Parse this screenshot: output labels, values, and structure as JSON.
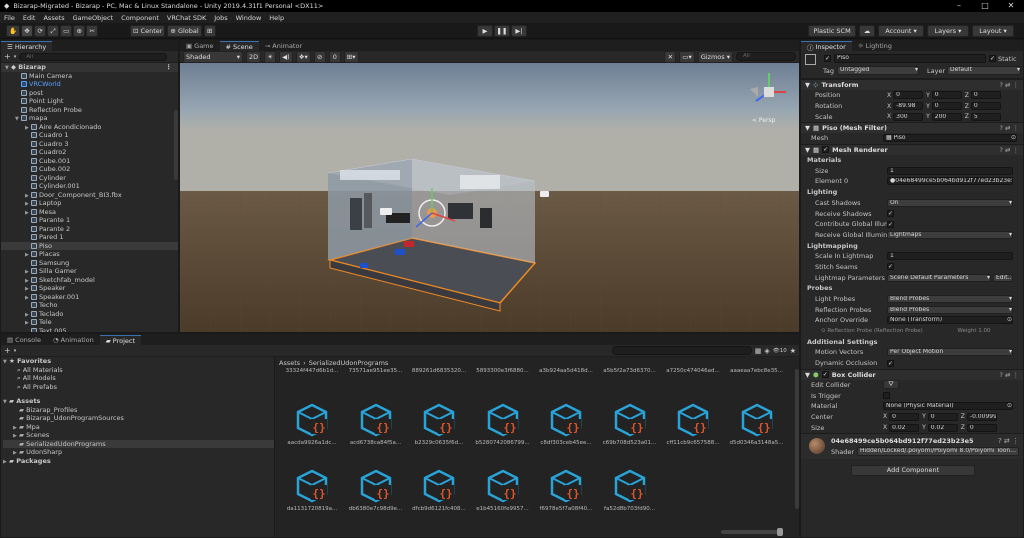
{
  "window": {
    "title": "Bizarap-Migrated - Bizarap - PC, Mac & Linux Standalone - Unity 2019.4.31f1 Personal <DX11>"
  },
  "menu": [
    "File",
    "Edit",
    "Assets",
    "GameObject",
    "Component",
    "VRChat SDK",
    "Jobs",
    "Window",
    "Help"
  ],
  "toolbar": {
    "pivot_label": "Center",
    "space_label": "Global",
    "plastic_label": "Plastic SCM",
    "account_label": "Account",
    "layers_label": "Layers",
    "layout_label": "Layout"
  },
  "hierarchy": {
    "tab": "Hierarchy",
    "search_placeholder": "All",
    "scene_name": "Bizarap",
    "items": [
      {
        "label": "Main Camera",
        "depth": 1,
        "arrow": "",
        "selected": false,
        "prefab": false
      },
      {
        "label": "VRCWorld",
        "depth": 1,
        "arrow": "",
        "selected": false,
        "prefab": true
      },
      {
        "label": "post",
        "depth": 1,
        "arrow": "",
        "selected": false,
        "prefab": false
      },
      {
        "label": "Point Light",
        "depth": 1,
        "arrow": "",
        "selected": false,
        "prefab": false
      },
      {
        "label": "Reflection Probe",
        "depth": 1,
        "arrow": "",
        "selected": false,
        "prefab": false
      },
      {
        "label": "mapa",
        "depth": 1,
        "arrow": "▼",
        "selected": false,
        "prefab": false
      },
      {
        "label": "Aire Acondicionado",
        "depth": 2,
        "arrow": "▶",
        "selected": false,
        "prefab": false
      },
      {
        "label": "Cuadro 1",
        "depth": 2,
        "arrow": "",
        "selected": false,
        "prefab": false
      },
      {
        "label": "Cuadro 3",
        "depth": 2,
        "arrow": "",
        "selected": false,
        "prefab": false
      },
      {
        "label": "Cuadro2",
        "depth": 2,
        "arrow": "",
        "selected": false,
        "prefab": false
      },
      {
        "label": "Cube.001",
        "depth": 2,
        "arrow": "",
        "selected": false,
        "prefab": false
      },
      {
        "label": "Cube.002",
        "depth": 2,
        "arrow": "",
        "selected": false,
        "prefab": false
      },
      {
        "label": "Cylinder",
        "depth": 2,
        "arrow": "",
        "selected": false,
        "prefab": false
      },
      {
        "label": "Cylinder.001",
        "depth": 2,
        "arrow": "",
        "selected": false,
        "prefab": false
      },
      {
        "label": "Door_Component_BI3.fbx",
        "depth": 2,
        "arrow": "▶",
        "selected": false,
        "prefab": false
      },
      {
        "label": "Laptop",
        "depth": 2,
        "arrow": "▶",
        "selected": false,
        "prefab": false
      },
      {
        "label": "Mesa",
        "depth": 2,
        "arrow": "▶",
        "selected": false,
        "prefab": false
      },
      {
        "label": "Parante 1",
        "depth": 2,
        "arrow": "",
        "selected": false,
        "prefab": false
      },
      {
        "label": "Parante 2",
        "depth": 2,
        "arrow": "",
        "selected": false,
        "prefab": false
      },
      {
        "label": "Pared 1",
        "depth": 2,
        "arrow": "",
        "selected": false,
        "prefab": false
      },
      {
        "label": "Piso",
        "depth": 2,
        "arrow": "",
        "selected": true,
        "prefab": false
      },
      {
        "label": "Placas",
        "depth": 2,
        "arrow": "▶",
        "selected": false,
        "prefab": false
      },
      {
        "label": "Samsung",
        "depth": 2,
        "arrow": "",
        "selected": false,
        "prefab": false
      },
      {
        "label": "Silla Gamer",
        "depth": 2,
        "arrow": "▶",
        "selected": false,
        "prefab": false
      },
      {
        "label": "Sketchfab_model",
        "depth": 2,
        "arrow": "▶",
        "selected": false,
        "prefab": false
      },
      {
        "label": "Speaker",
        "depth": 2,
        "arrow": "▶",
        "selected": false,
        "prefab": false
      },
      {
        "label": "Speaker.001",
        "depth": 2,
        "arrow": "▶",
        "selected": false,
        "prefab": false
      },
      {
        "label": "Techo",
        "depth": 2,
        "arrow": "",
        "selected": false,
        "prefab": false
      },
      {
        "label": "Teclado",
        "depth": 2,
        "arrow": "▶",
        "selected": false,
        "prefab": false
      },
      {
        "label": "Tele",
        "depth": 2,
        "arrow": "▶",
        "selected": false,
        "prefab": false
      },
      {
        "label": "Text.005",
        "depth": 2,
        "arrow": "",
        "selected": false,
        "prefab": false
      }
    ]
  },
  "scene": {
    "tabs": [
      "Game",
      "Scene",
      "Animator"
    ],
    "shading": "Shaded",
    "mode_2d": "2D",
    "layer_count": "0",
    "gizmos_label": "Gizmos",
    "search_placeholder": "All",
    "persp_label": "< Persp"
  },
  "inspector": {
    "tabs": [
      "Inspector",
      "Lighting"
    ],
    "object_name": "Piso",
    "static_label": "Static",
    "tag_label": "Tag",
    "tag_value": "Untagged",
    "layer_label": "Layer",
    "layer_value": "Default",
    "transform": {
      "title": "Transform",
      "position_label": "Position",
      "rotation_label": "Rotation",
      "scale_label": "Scale",
      "position": [
        "0",
        "0",
        "0"
      ],
      "rotation": [
        "-89.98",
        "0",
        "0"
      ],
      "scale": [
        "300",
        "200",
        "5"
      ]
    },
    "mesh_filter": {
      "title": "Piso (Mesh Filter)",
      "mesh_label": "Mesh",
      "mesh_value": "Piso"
    },
    "mesh_renderer": {
      "title": "Mesh Renderer",
      "materials_label": "Materials",
      "size_label": "Size",
      "size_value": "1",
      "element_label": "Element 0",
      "element_value": "04e68499ce5b064bd912f77ed23b23e5",
      "lighting_label": "Lighting",
      "cast_label": "Cast Shadows",
      "cast_value": "On",
      "receive_label": "Receive Shadows",
      "contribute_label": "Contribute Global Illumi",
      "receive_gi_label": "Receive Global Illuminat",
      "receive_gi_value": "Lightmaps",
      "lightmapping_label": "Lightmapping",
      "scale_label": "Scale In Lightmap",
      "scale_value": "1",
      "stitch_label": "Stitch Seams",
      "params_label": "Lightmap Parameters",
      "params_value": "Scene Default Parameters",
      "edit_label": "Edit...",
      "probes_label": "Probes",
      "light_probes_label": "Light Probes",
      "light_probes_value": "Blend Probes",
      "refl_probes_label": "Reflection Probes",
      "refl_probes_value": "Blend Probes",
      "anchor_label": "Anchor Override",
      "anchor_value": "None (Transform)",
      "probe_row": "Reflection Probe (Reflection Probe)",
      "weight": "Weight 1.00",
      "additional_label": "Additional Settings",
      "motion_label": "Motion Vectors",
      "motion_value": "Per Object Motion",
      "dynamic_label": "Dynamic Occlusion"
    },
    "box_collider": {
      "title": "Box Collider",
      "edit_label": "Edit Collider",
      "trigger_label": "Is Trigger",
      "material_label": "Material",
      "material_value": "None (Physic Material)",
      "center_label": "Center",
      "center": [
        "0",
        "0",
        "-0.009999"
      ],
      "size_label": "Size",
      "size": [
        "0.02",
        "0.02",
        "0"
      ]
    },
    "material": {
      "name": "04e68499ce5b064bd912f77ed23b23e5",
      "shader_label": "Shader",
      "shader_value": "Hidden/Locked/.poiyomi/Poiyomi 8.0/Poiyomi Toon..."
    },
    "add_component": "Add Component"
  },
  "bottom": {
    "tabs": [
      "Console",
      "Animation",
      "Project"
    ],
    "favorites_label": "Favorites",
    "favorites": [
      "All Materials",
      "All Models",
      "All Prefabs"
    ],
    "assets_label": "Assets",
    "folders": [
      {
        "label": "Bizarap_Profiles",
        "arrow": "",
        "selected": false
      },
      {
        "label": "Bizarap_UdonProgramSources",
        "arrow": "",
        "selected": false
      },
      {
        "label": "Mpa",
        "arrow": "▶",
        "selected": false
      },
      {
        "label": "Scenes",
        "arrow": "▶",
        "selected": false
      },
      {
        "label": "SerializedUdonPrograms",
        "arrow": "",
        "selected": true
      },
      {
        "label": "UdonSharp",
        "arrow": "▶",
        "selected": false
      }
    ],
    "packages_label": "Packages",
    "badge_count": "10",
    "breadcrumb": [
      "Assets",
      "SerializedUdonPrograms"
    ],
    "assets_row0": [
      "33324f447d6b1d...",
      "73571ae951ee35...",
      "889261d6835320...",
      "5893300e3f6880...",
      "a3b924aa5d418d...",
      "a5b5f2a73d6370...",
      "a7250c474046ad...",
      "aaaeaa7ebc8e35..."
    ],
    "assets_row1": [
      "aacda9926a1dc...",
      "acd6738ca84f5a...",
      "b2329c0635f6d...",
      "b5280742086799...",
      "c8df303ceb45ee...",
      "c69b708d523a01...",
      "cff11cb9c657588...",
      "d5d0346a3148a5..."
    ],
    "assets_row2": [
      "da1131720819a...",
      "db6380e7c98d9e...",
      "dfcb9d6121fc408...",
      "e1b45160fe9957...",
      "f6978e5f7a08f40...",
      "fa52d8b703fd90..."
    ]
  },
  "colors": {
    "accent": "#3a72b0",
    "selection": "#3a3a3a",
    "asset_icon": "#29a3d8",
    "asset_badge": "#e0562a"
  }
}
